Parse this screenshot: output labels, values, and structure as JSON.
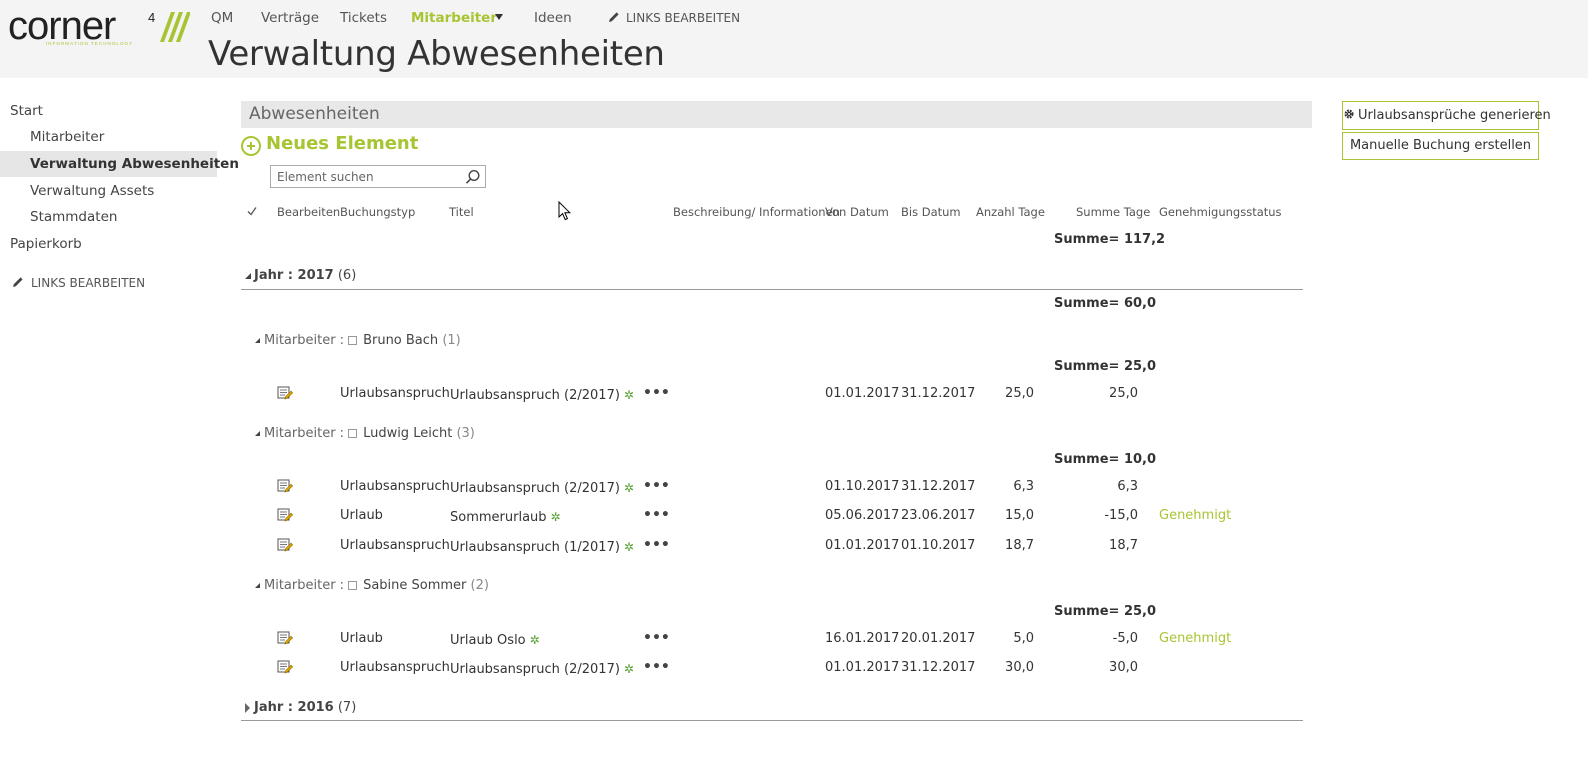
{
  "logo": {
    "text": "corner",
    "superscript": "4",
    "tagline": "INFORMATION TECHNOLOGY",
    "brand_color": "#a7c532"
  },
  "topnav": {
    "items": [
      {
        "label": "QM"
      },
      {
        "label": "Verträge"
      },
      {
        "label": "Tickets"
      },
      {
        "label": "Mitarbeiter",
        "active": true
      },
      {
        "label": "Ideen"
      }
    ],
    "edit_links": "LINKS BEARBEITEN"
  },
  "page_title": "Verwaltung Abwesenheiten",
  "leftnav": {
    "items": [
      {
        "label": "Start"
      },
      {
        "label": "Mitarbeiter"
      },
      {
        "label": "Verwaltung Abwesenheiten",
        "selected": true
      },
      {
        "label": "Verwaltung Assets"
      },
      {
        "label": "Stammdaten"
      },
      {
        "label": "Papierkorb"
      }
    ],
    "edit_links": "LINKS BEARBEITEN"
  },
  "list": {
    "title": "Abwesenheiten",
    "new_item": "Neues Element",
    "search_placeholder": "Element suchen",
    "columns": [
      "Bearbeiten",
      "Buchungstyp",
      "Titel",
      "Beschreibung/ Informationen",
      "Von Datum",
      "Bis Datum",
      "Anzahl Tage",
      "Summe Tage",
      "Genehmigungsstatus"
    ],
    "total_sum_label": "Summe=",
    "total_sum": "117,2",
    "groups": [
      {
        "label": "Jahr : 2017",
        "count": "(6)",
        "sum": "60,0",
        "subgroups": [
          {
            "label": "Mitarbeiter :",
            "name": "Bruno Bach",
            "count": "(1)",
            "sum": "25,0",
            "rows": [
              {
                "type": "Urlaubsanspruch",
                "title": "Urlaubsanspruch (2/2017)",
                "from": "01.01.2017",
                "to": "31.12.2017",
                "days": "25,0",
                "sum": "25,0",
                "status": ""
              }
            ]
          },
          {
            "label": "Mitarbeiter :",
            "name": "Ludwig Leicht",
            "count": "(3)",
            "sum": "10,0",
            "rows": [
              {
                "type": "Urlaubsanspruch",
                "title": "Urlaubsanspruch (2/2017)",
                "from": "01.10.2017",
                "to": "31.12.2017",
                "days": "6,3",
                "sum": "6,3",
                "status": ""
              },
              {
                "type": "Urlaub",
                "title": "Sommerurlaub",
                "from": "05.06.2017",
                "to": "23.06.2017",
                "days": "15,0",
                "sum": "-15,0",
                "status": "Genehmigt"
              },
              {
                "type": "Urlaubsanspruch",
                "title": "Urlaubsanspruch (1/2017)",
                "from": "01.01.2017",
                "to": "01.10.2017",
                "days": "18,7",
                "sum": "18,7",
                "status": ""
              }
            ]
          },
          {
            "label": "Mitarbeiter :",
            "name": "Sabine Sommer",
            "count": "(2)",
            "sum": "25,0",
            "rows": [
              {
                "type": "Urlaub",
                "title": "Urlaub Oslo",
                "from": "16.01.2017",
                "to": "20.01.2017",
                "days": "5,0",
                "sum": "-5,0",
                "status": "Genehmigt"
              },
              {
                "type": "Urlaubsanspruch",
                "title": "Urlaubsanspruch (2/2017)",
                "from": "01.01.2017",
                "to": "31.12.2017",
                "days": "30,0",
                "sum": "30,0",
                "status": ""
              }
            ]
          }
        ]
      },
      {
        "label": "Jahr : 2016",
        "count": "(7)"
      }
    ],
    "new_badge": "✲"
  },
  "actions": {
    "generate": "Urlaubsansprüche generieren",
    "manual": "Manuelle Buchung erstellen"
  }
}
